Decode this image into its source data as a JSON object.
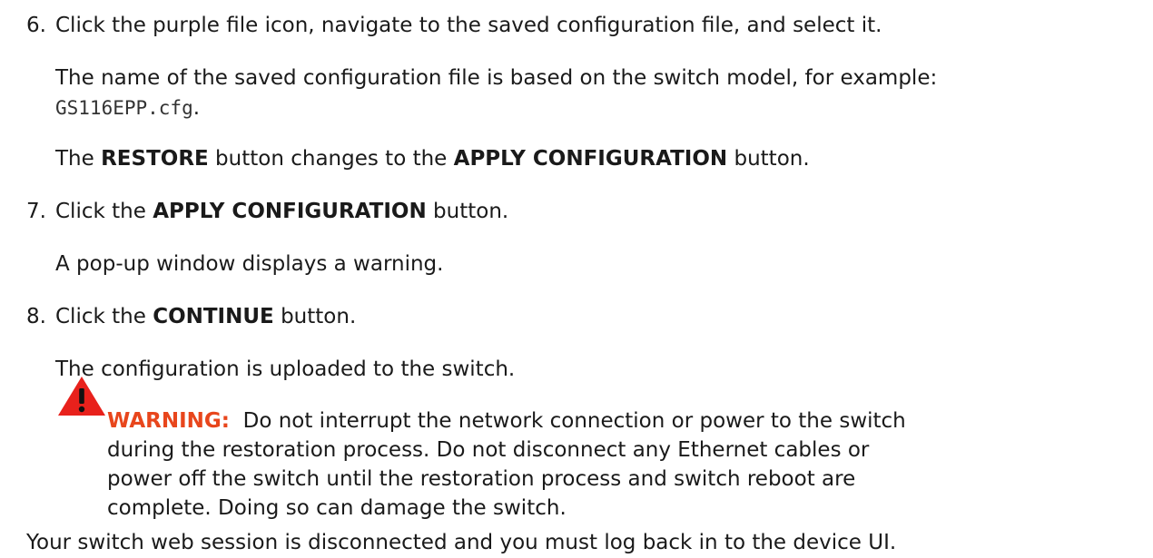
{
  "steps": [
    {
      "number": "6.",
      "instruction": "Click the purple file icon, navigate to the saved configuration file, and select it.",
      "note_line1": "The name of the saved configuration file is based on the switch model, for example:",
      "note_code": "GS116EPP.cfg",
      "note_code_suffix": ".",
      "result_prefix": "The ",
      "result_bold1": "RESTORE",
      "result_middle": " button changes to the ",
      "result_bold2": "APPLY CONFIGURATION",
      "result_suffix": " button."
    },
    {
      "number": "7.",
      "instruction_prefix": "Click the ",
      "instruction_bold": "APPLY CONFIGURATION",
      "instruction_suffix": " button.",
      "result": "A pop-up window displays a warning."
    },
    {
      "number": "8.",
      "instruction_prefix": "Click the ",
      "instruction_bold": "CONTINUE",
      "instruction_suffix": " button.",
      "result": "The configuration is uploaded to the switch."
    }
  ],
  "warning": {
    "label": "WARNING:",
    "line1": "Do not interrupt the network connection or power to the switch",
    "line2": "during the restoration process. Do not disconnect any Ethernet cables or",
    "line3": "power off the switch until the restoration process and switch reboot are",
    "line4": "complete. Doing so can damage the switch.",
    "icon": "warning-triangle-icon",
    "label_color": "#e8461c",
    "icon_color": "#e8211c"
  },
  "footer": "Your switch web session is disconnected and you must log back in to the device UI."
}
